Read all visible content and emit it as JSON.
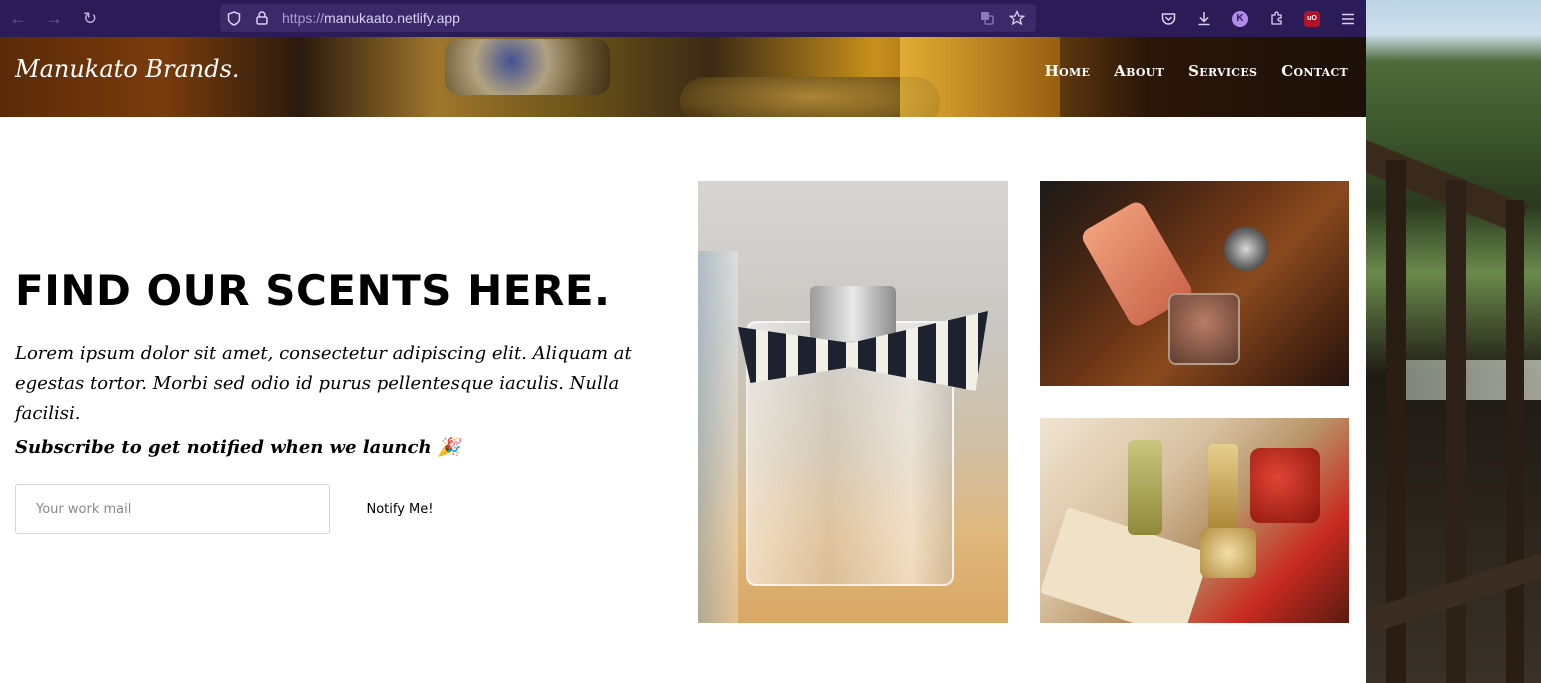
{
  "browser": {
    "url_protocol": "https://",
    "url_host": "manukaato.netlify.app",
    "profile_initial": "K",
    "ublock_label": "uO"
  },
  "site": {
    "brand": "Manukato Brands.",
    "nav": [
      {
        "label": "Home"
      },
      {
        "label": "About"
      },
      {
        "label": "Services"
      },
      {
        "label": "Contact"
      }
    ]
  },
  "hero": {
    "title": "FIND OUR SCENTS HERE.",
    "description": "Lorem ipsum dolor sit amet, consectetur adipiscing elit. Aliquam at egestas tortor. Morbi sed odio id purus pellentesque iaculis. Nulla facilisi.",
    "subscribe_text": "Subscribe to get notified when we launch 🎉",
    "email_placeholder": "Your work mail",
    "email_value": "",
    "button_label": "Notify Me!"
  },
  "colors": {
    "browser_toolbar": "#2b1b56",
    "urlbar": "#3a2a6a",
    "text": "#000000"
  },
  "icons": [
    "back-arrow-icon",
    "forward-arrow-icon",
    "reload-icon",
    "shield-icon",
    "lock-icon",
    "translate-icon",
    "bookmark-star-icon",
    "pocket-icon",
    "download-icon",
    "account-icon",
    "extensions-icon",
    "ublock-icon",
    "menu-icon"
  ]
}
